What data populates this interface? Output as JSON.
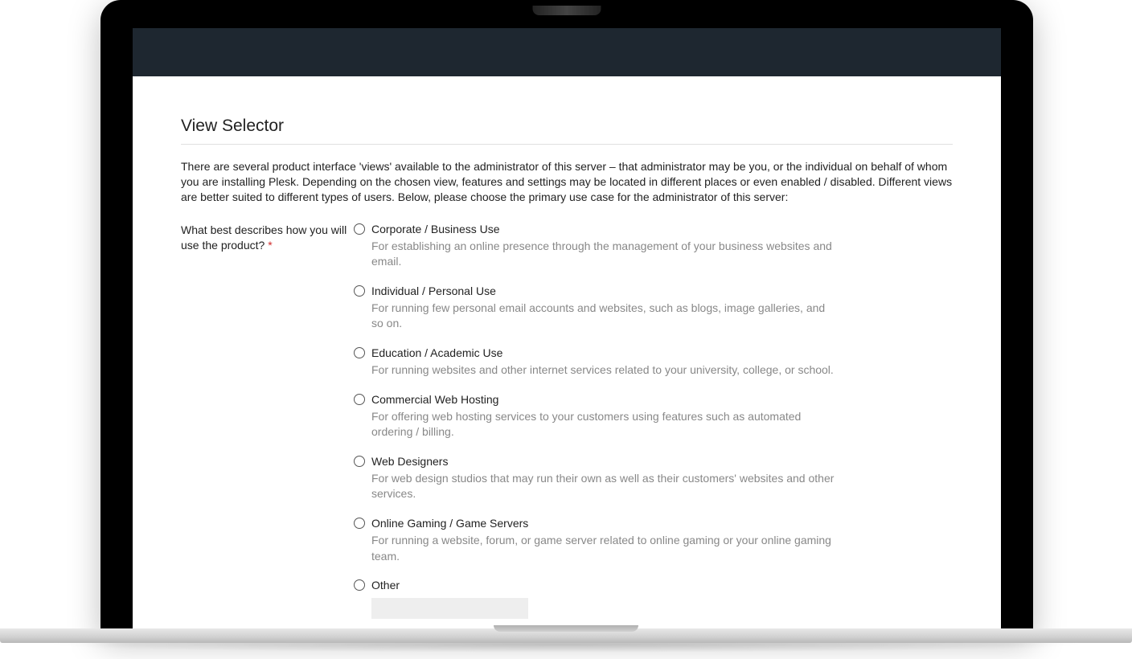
{
  "page": {
    "title": "View Selector",
    "intro": "There are several product interface 'views' available to the administrator of this server – that administrator may be you, or the individual on behalf of whom you are installing Plesk. Depending on the chosen view, features and settings may be located in different places or even enabled / disabled. Different views are better suited to different types of users. Below, please choose the primary use case for the administrator of this server:"
  },
  "form": {
    "question_label": "What best describes how you will use the product?",
    "required_mark": "*"
  },
  "options": [
    {
      "label": "Corporate / Business Use",
      "description": "For establishing an online presence through the management of your business websites and email."
    },
    {
      "label": "Individual / Personal Use",
      "description": "For running few personal email accounts and websites, such as blogs, image galleries, and so on."
    },
    {
      "label": "Education / Academic Use",
      "description": "For running websites and other internet services related to your university, college, or school."
    },
    {
      "label": "Commercial Web Hosting",
      "description": "For offering web hosting services to your customers using features such as automated ordering / billing."
    },
    {
      "label": "Web Designers",
      "description": "For web design studios that may run their own as well as their customers' websites and other services."
    },
    {
      "label": "Online Gaming / Game Servers",
      "description": "For running a website, forum, or game server related to online gaming or your online gaming team."
    },
    {
      "label": "Other",
      "description": ""
    }
  ]
}
